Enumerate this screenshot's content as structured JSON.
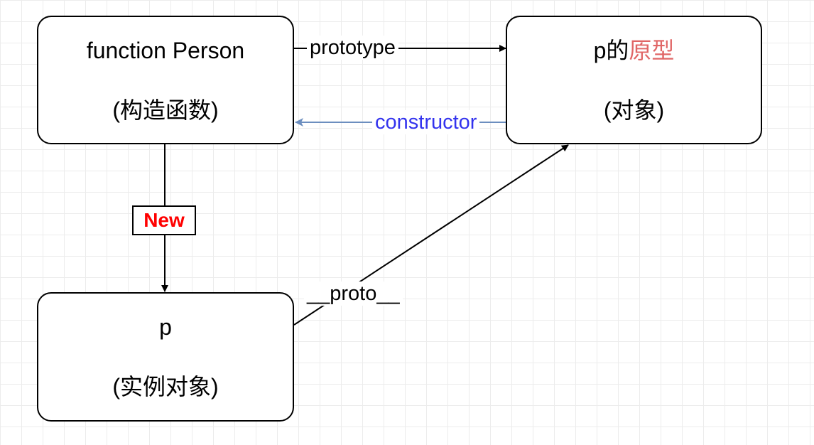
{
  "nodes": {
    "person": {
      "title": "function Person",
      "subtitle": "(构造函数)"
    },
    "proto_obj": {
      "title_prefix": "p的",
      "title_accent": "原型",
      "subtitle": "(对象)"
    },
    "instance": {
      "title": "p",
      "subtitle": "(实例对象)"
    }
  },
  "edges": {
    "prototype": "prototype",
    "constructor": "constructor",
    "new": "New",
    "proto": "__proto__"
  },
  "colors": {
    "accent": "#e06666",
    "constructor_text": "#3333ee",
    "constructor_line": "#6c8ebf",
    "new_text": "#ff0000"
  }
}
